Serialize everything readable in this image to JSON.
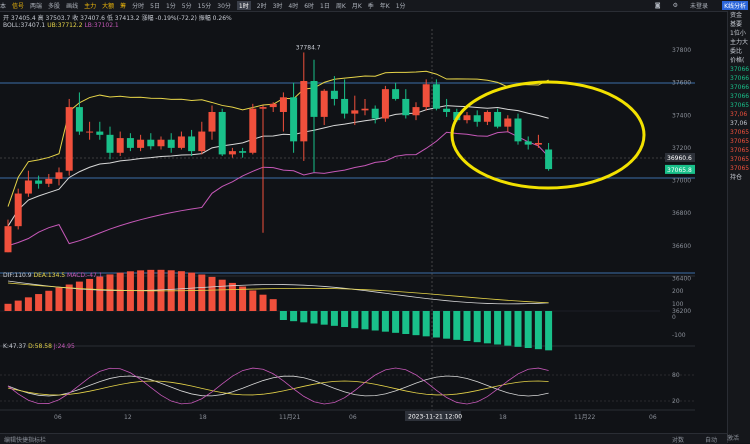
{
  "toolbar": {
    "items": [
      "本",
      "信号",
      "两端",
      "多股",
      "画线",
      "分时",
      "5日",
      "1分",
      "5分",
      "15分",
      "30分",
      "1时",
      "2时",
      "3时",
      "4时",
      "6时",
      "1日",
      "周K",
      "月K",
      "季",
      "年K",
      "1分"
    ],
    "main_force": "主力",
    "big_order": "大额",
    "wait": "筹",
    "right_items": [
      "未登录"
    ],
    "badge": "K线分析"
  },
  "indicators": {
    "ohlc": "开 37405.4 高 37503.7 收 37407.6 低 37413.2 涨幅 -0.19%(-72.2) 振幅 0.26%",
    "boll_name": "BOLL:37407.1",
    "boll_ub": "UB:37712.2",
    "boll_lb": "LB:37102.1",
    "macd_name": "DIF:110.9",
    "macd_dea": "DEA:134.5",
    "macd_val": "MACD:-47.1",
    "kdj_k": "K:47.37",
    "kdj_d": "D:58.58",
    "kdj_j": "J:24.95"
  },
  "chart_data": {
    "type": "candlestick",
    "y_axis_ticks": [
      37800,
      37600,
      37400,
      37200,
      37000,
      36800,
      36600,
      36400,
      36200
    ],
    "high_label": "37784.7",
    "current_price_label": "37065.8",
    "crosshair_price_label": "36960.6",
    "macd_ticks": [
      200,
      100,
      0,
      -100
    ],
    "kdj_ticks": [
      80,
      20
    ],
    "x_labels": [
      "06",
      "12",
      "18",
      "11月21",
      "06",
      "12",
      "18",
      "11月22",
      "06"
    ],
    "crosshair_time": "2023-11-21 12:00",
    "candles": [
      {
        "o": 36560,
        "h": 36760,
        "l": 36560,
        "c": 36720
      },
      {
        "o": 36720,
        "h": 36950,
        "l": 36700,
        "c": 36920
      },
      {
        "o": 36920,
        "h": 37060,
        "l": 36900,
        "c": 37000
      },
      {
        "o": 37000,
        "h": 37030,
        "l": 36950,
        "c": 36980
      },
      {
        "o": 36980,
        "h": 37040,
        "l": 36960,
        "c": 37010
      },
      {
        "o": 37010,
        "h": 37080,
        "l": 36970,
        "c": 37050
      },
      {
        "o": 37060,
        "h": 37500,
        "l": 37030,
        "c": 37450
      },
      {
        "o": 37450,
        "h": 37540,
        "l": 37280,
        "c": 37300
      },
      {
        "o": 37300,
        "h": 37360,
        "l": 37250,
        "c": 37300
      },
      {
        "o": 37300,
        "h": 37360,
        "l": 37250,
        "c": 37280
      },
      {
        "o": 37280,
        "h": 37330,
        "l": 37130,
        "c": 37170
      },
      {
        "o": 37170,
        "h": 37300,
        "l": 37150,
        "c": 37260
      },
      {
        "o": 37260,
        "h": 37290,
        "l": 37180,
        "c": 37200
      },
      {
        "o": 37200,
        "h": 37280,
        "l": 37180,
        "c": 37250
      },
      {
        "o": 37250,
        "h": 37290,
        "l": 37190,
        "c": 37210
      },
      {
        "o": 37210,
        "h": 37270,
        "l": 37190,
        "c": 37250
      },
      {
        "o": 37250,
        "h": 37290,
        "l": 37170,
        "c": 37200
      },
      {
        "o": 37200,
        "h": 37300,
        "l": 37190,
        "c": 37270
      },
      {
        "o": 37270,
        "h": 37310,
        "l": 37150,
        "c": 37180
      },
      {
        "o": 37180,
        "h": 37360,
        "l": 37160,
        "c": 37300
      },
      {
        "o": 37300,
        "h": 37460,
        "l": 37250,
        "c": 37420
      },
      {
        "o": 37420,
        "h": 37440,
        "l": 37150,
        "c": 37160
      },
      {
        "o": 37160,
        "h": 37200,
        "l": 37140,
        "c": 37180
      },
      {
        "o": 37180,
        "h": 37200,
        "l": 37140,
        "c": 37170
      },
      {
        "o": 37170,
        "h": 37470,
        "l": 37160,
        "c": 37440
      },
      {
        "o": 37440,
        "h": 37460,
        "l": 36680,
        "c": 37450
      },
      {
        "o": 37450,
        "h": 37480,
        "l": 37420,
        "c": 37470
      },
      {
        "o": 37420,
        "h": 37540,
        "l": 37300,
        "c": 37510
      },
      {
        "o": 37510,
        "h": 37600,
        "l": 37170,
        "c": 37240
      },
      {
        "o": 37240,
        "h": 37785,
        "l": 37120,
        "c": 37610
      },
      {
        "o": 37610,
        "h": 37740,
        "l": 37050,
        "c": 37390
      },
      {
        "o": 37390,
        "h": 37560,
        "l": 37340,
        "c": 37550
      },
      {
        "o": 37550,
        "h": 37640,
        "l": 37460,
        "c": 37500
      },
      {
        "o": 37500,
        "h": 37620,
        "l": 37380,
        "c": 37410
      },
      {
        "o": 37410,
        "h": 37520,
        "l": 37340,
        "c": 37430
      },
      {
        "o": 37430,
        "h": 37500,
        "l": 37400,
        "c": 37440
      },
      {
        "o": 37440,
        "h": 37460,
        "l": 37350,
        "c": 37380
      },
      {
        "o": 37380,
        "h": 37580,
        "l": 37360,
        "c": 37560
      },
      {
        "o": 37560,
        "h": 37600,
        "l": 37490,
        "c": 37500
      },
      {
        "o": 37500,
        "h": 37560,
        "l": 37380,
        "c": 37400
      },
      {
        "o": 37400,
        "h": 37480,
        "l": 37370,
        "c": 37450
      },
      {
        "o": 37450,
        "h": 37620,
        "l": 37430,
        "c": 37590
      },
      {
        "o": 37590,
        "h": 37620,
        "l": 37430,
        "c": 37440
      },
      {
        "o": 37440,
        "h": 37500,
        "l": 37390,
        "c": 37420
      },
      {
        "o": 37420,
        "h": 37440,
        "l": 37360,
        "c": 37370
      },
      {
        "o": 37370,
        "h": 37420,
        "l": 37350,
        "c": 37400
      },
      {
        "o": 37400,
        "h": 37430,
        "l": 37330,
        "c": 37360
      },
      {
        "o": 37360,
        "h": 37430,
        "l": 37340,
        "c": 37420
      },
      {
        "o": 37420,
        "h": 37440,
        "l": 37320,
        "c": 37330
      },
      {
        "o": 37330,
        "h": 37400,
        "l": 37300,
        "c": 37380
      },
      {
        "o": 37380,
        "h": 37410,
        "l": 37220,
        "c": 37240
      },
      {
        "o": 37240,
        "h": 37270,
        "l": 37190,
        "c": 37220
      },
      {
        "o": 37220,
        "h": 37280,
        "l": 37200,
        "c": 37230
      },
      {
        "o": 37190,
        "h": 37230,
        "l": 37060,
        "c": 37070
      }
    ]
  },
  "sidebar": {
    "lines": [
      {
        "t": "资金",
        "c": ""
      },
      {
        "t": "基要",
        "c": ""
      },
      {
        "t": "",
        "c": ""
      },
      {
        "t": "1位小",
        "c": ""
      },
      {
        "t": "",
        "c": ""
      },
      {
        "t": "主力大",
        "c": ""
      },
      {
        "t": "",
        "c": ""
      },
      {
        "t": "委比",
        "c": ""
      },
      {
        "t": "",
        "c": ""
      },
      {
        "t": "价格(",
        "c": ""
      },
      {
        "t": "37066",
        "c": "g"
      },
      {
        "t": "37066",
        "c": "g"
      },
      {
        "t": "37066",
        "c": "g"
      },
      {
        "t": "37066",
        "c": "g"
      },
      {
        "t": "37065",
        "c": "g"
      },
      {
        "t": "",
        "c": ""
      },
      {
        "t": "37,06",
        "c": "r"
      },
      {
        "t": "37,06",
        "c": ""
      },
      {
        "t": "37065",
        "c": "r"
      },
      {
        "t": "37065",
        "c": "r"
      },
      {
        "t": "37065",
        "c": "r"
      },
      {
        "t": "37065",
        "c": "r"
      },
      {
        "t": "37065",
        "c": "r"
      },
      {
        "t": "",
        "c": ""
      },
      {
        "t": "持仓",
        "c": ""
      }
    ]
  },
  "footer": {
    "left": "编辑快捷指标栏",
    "right1": "对数",
    "right2": "自动",
    "right3": "激活"
  }
}
